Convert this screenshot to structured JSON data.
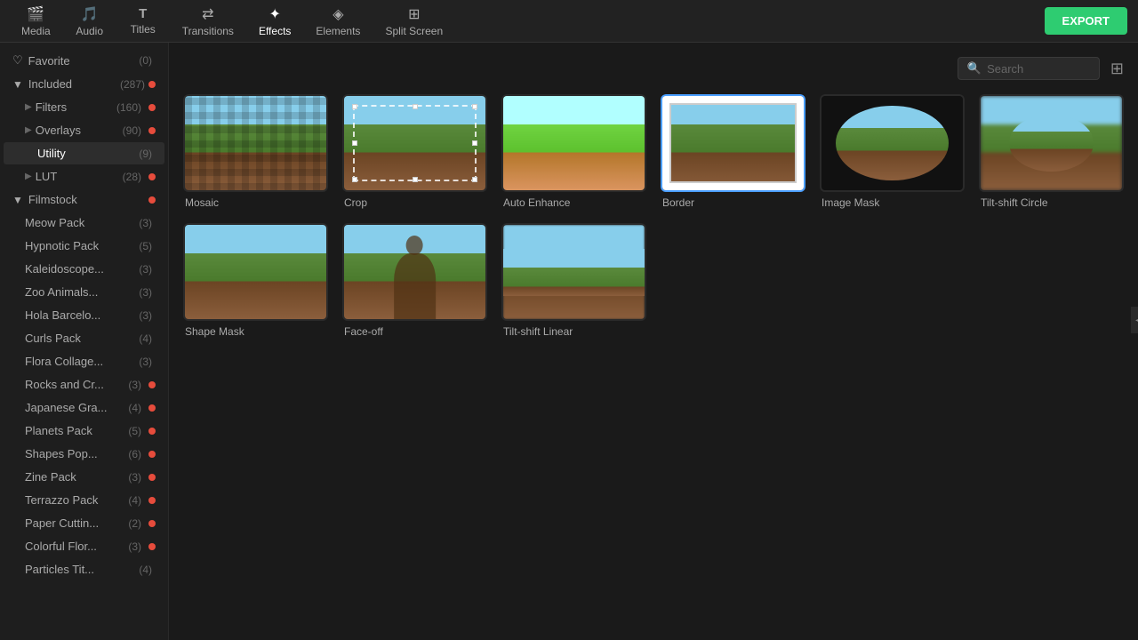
{
  "app": {
    "export_label": "EXPORT"
  },
  "topnav": {
    "items": [
      {
        "id": "media",
        "label": "Media",
        "icon": "🎬"
      },
      {
        "id": "audio",
        "label": "Audio",
        "icon": "🎵"
      },
      {
        "id": "titles",
        "label": "Titles",
        "icon": "T"
      },
      {
        "id": "transitions",
        "label": "Transitions",
        "icon": "↔"
      },
      {
        "id": "effects",
        "label": "Effects",
        "icon": "✦",
        "active": true
      },
      {
        "id": "elements",
        "label": "Elements",
        "icon": "◈"
      },
      {
        "id": "split_screen",
        "label": "Split Screen",
        "icon": "⊞"
      }
    ]
  },
  "sidebar": {
    "favorite": {
      "label": "Favorite",
      "count": "(0)"
    },
    "included": {
      "label": "Included",
      "count": "(287)",
      "dot": "red",
      "children": [
        {
          "id": "filters",
          "label": "Filters",
          "count": "(160)",
          "dot": "red"
        },
        {
          "id": "overlays",
          "label": "Overlays",
          "count": "(90)",
          "dot": "red"
        },
        {
          "id": "utility",
          "label": "Utility",
          "count": "(9)",
          "active": true
        },
        {
          "id": "lut",
          "label": "LUT",
          "count": "(28)",
          "dot": "red"
        }
      ]
    },
    "filmstock": {
      "label": "Filmstock",
      "dot": "red",
      "children": [
        {
          "id": "meow_pack",
          "label": "Meow Pack",
          "count": "(3)"
        },
        {
          "id": "hypnotic_pack",
          "label": "Hypnotic Pack",
          "count": "(5)"
        },
        {
          "id": "kaleidoscope",
          "label": "Kaleidoscope...",
          "count": "(3)"
        },
        {
          "id": "zoo_animals",
          "label": "Zoo Animals...",
          "count": "(3)"
        },
        {
          "id": "hola_barcelona",
          "label": "Hola Barcelo...",
          "count": "(3)"
        },
        {
          "id": "curls_pack",
          "label": "Curls Pack",
          "count": "(4)"
        },
        {
          "id": "flora_collage",
          "label": "Flora Collage...",
          "count": "(3)"
        },
        {
          "id": "rocks_and_cr",
          "label": "Rocks and Cr...",
          "count": "(3)",
          "dot": "red"
        },
        {
          "id": "japanese_gra",
          "label": "Japanese Gra...",
          "count": "(4)",
          "dot": "red"
        },
        {
          "id": "planets_pack",
          "label": "Planets Pack",
          "count": "(5)",
          "dot": "red"
        },
        {
          "id": "shapes_pop",
          "label": "Shapes Pop...",
          "count": "(6)",
          "dot": "red"
        },
        {
          "id": "zine_pack",
          "label": "Zine Pack",
          "count": "(3)",
          "dot": "red"
        },
        {
          "id": "terrazzo_pack",
          "label": "Terrazzo Pack",
          "count": "(4)",
          "dot": "red"
        },
        {
          "id": "paper_cutting",
          "label": "Paper Cuttin...",
          "count": "(2)",
          "dot": "red"
        },
        {
          "id": "colorful_flora",
          "label": "Colorful Flor...",
          "count": "(3)",
          "dot": "red"
        },
        {
          "id": "particles_tit",
          "label": "Particles Tit...",
          "count": "(4)"
        }
      ]
    }
  },
  "search": {
    "placeholder": "Search"
  },
  "effects": [
    {
      "id": "mosaic",
      "label": "Mosaic",
      "type": "mosaic"
    },
    {
      "id": "crop",
      "label": "Crop",
      "type": "crop"
    },
    {
      "id": "auto_enhance",
      "label": "Auto Enhance",
      "type": "enhance"
    },
    {
      "id": "border",
      "label": "Border",
      "type": "border",
      "selected": true
    },
    {
      "id": "image_mask",
      "label": "Image Mask",
      "type": "imagemask"
    },
    {
      "id": "tilt_shift_circle",
      "label": "Tilt-shift Circle",
      "type": "tiltcircle"
    },
    {
      "id": "shape_mask",
      "label": "Shape Mask",
      "type": "shapemask"
    },
    {
      "id": "face_off",
      "label": "Face-off",
      "type": "faceoff"
    },
    {
      "id": "tilt_shift_linear",
      "label": "Tilt-shift Linear",
      "type": "tiltlinear"
    }
  ]
}
